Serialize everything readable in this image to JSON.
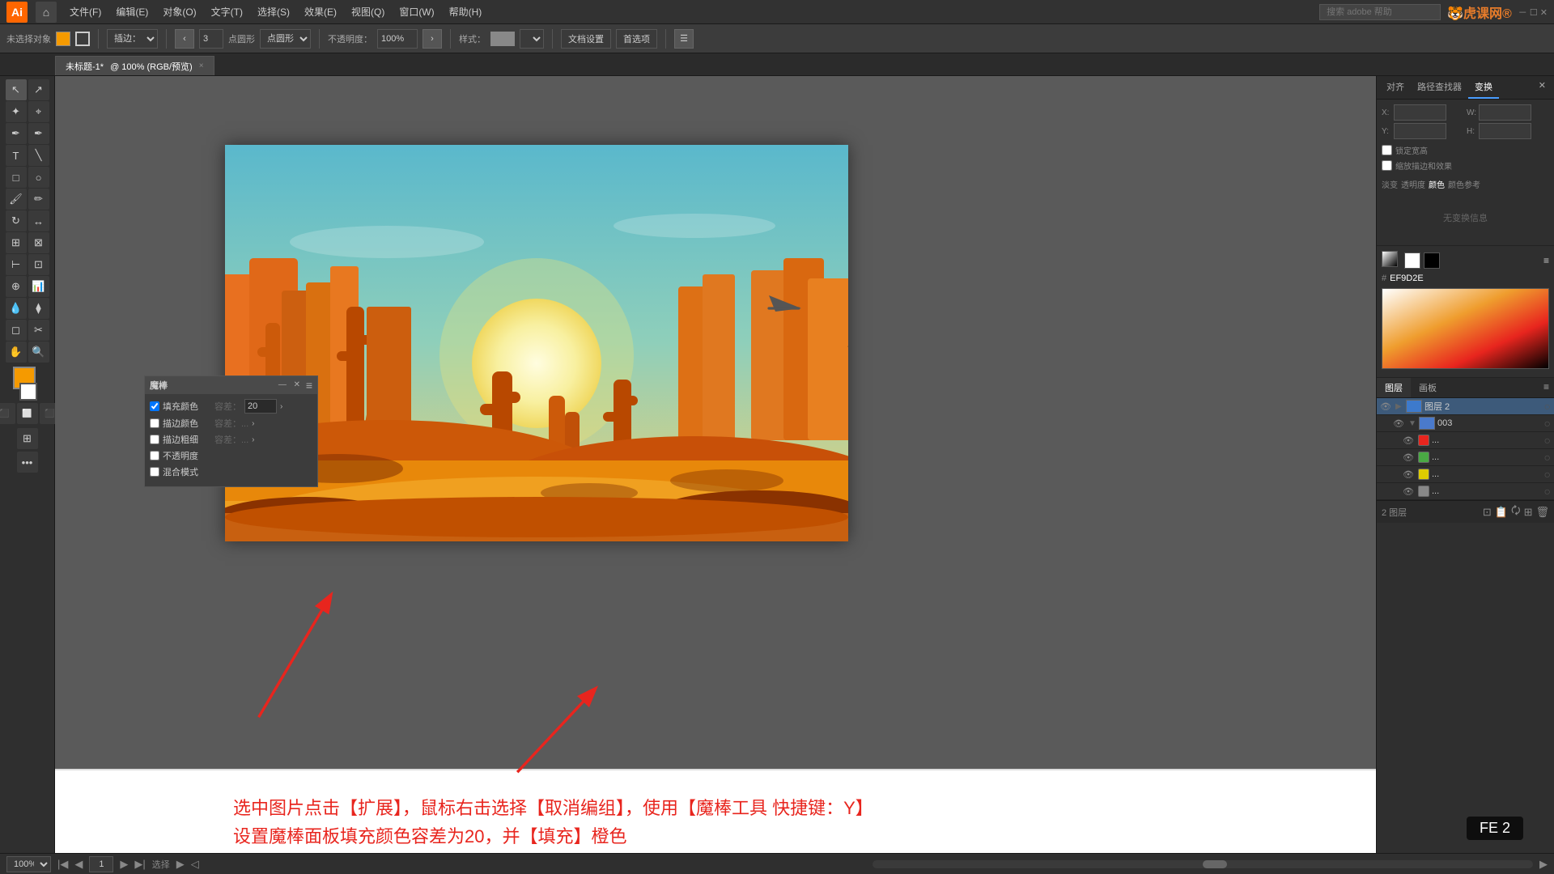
{
  "app": {
    "name": "Adobe Illustrator",
    "logo": "Ai",
    "version": "FE 2"
  },
  "menubar": {
    "items": [
      "文件(F)",
      "编辑(E)",
      "对象(O)",
      "文字(T)",
      "选择(S)",
      "效果(E)",
      "视图(Q)",
      "窗口(W)",
      "帮助(H)"
    ],
    "search_placeholder": "搜索 adobe 帮助",
    "home_icon": "⌂"
  },
  "toolbar": {
    "fill_label": "未选择对象",
    "stroke_label": "描边：",
    "warp_label": "插边：",
    "points_label": "3",
    "shape_label": "点圆形",
    "opacity_label": "不透明度：",
    "opacity_value": "100%",
    "style_label": "样式：",
    "doc_settings_label": "文档设置",
    "prefs_label": "首选项"
  },
  "tab": {
    "title": "未标题-1*",
    "subtitle": "@ 100% (RGB/预览)",
    "close_icon": "×"
  },
  "magic_wand": {
    "panel_title": "魔棒",
    "fill_color_label": "填充颜色",
    "fill_color_checked": true,
    "tolerance_label": "容差：",
    "tolerance_value": "20",
    "stroke_color_label": "描边颜色",
    "stroke_color_checked": false,
    "stroke_weight_label": "描边粗细",
    "stroke_weight_checked": false,
    "opacity_label": "不透明度",
    "opacity_checked": false,
    "blend_mode_label": "混合模式",
    "blend_mode_checked": false,
    "dim_text": "容差：",
    "dim_value": "..."
  },
  "right_panel": {
    "tabs": [
      "对齐",
      "路径查找器",
      "变换"
    ],
    "active_tab": "变换",
    "close_icon": "×",
    "no_status": "无变换信息",
    "checkboxes": [
      "锁定宽高",
      "缩放描边和效果"
    ],
    "color_hex": "EF9D2E",
    "panels": [
      "淡变",
      "透明度",
      "颜色",
      "颜色参考"
    ]
  },
  "layers_panel": {
    "tabs": [
      "图层",
      "画板"
    ],
    "active_tab": "图层",
    "layers": [
      {
        "name": "图层 2",
        "expanded": true,
        "selected": true,
        "color": "#4488ff"
      },
      {
        "name": "003",
        "expanded": false,
        "selected": false,
        "color": "#4488ff"
      },
      {
        "name": "...",
        "color": "#e8251e"
      },
      {
        "name": "...",
        "color": "#4aaa44"
      },
      {
        "name": "...",
        "color": "#ddcc00"
      },
      {
        "name": "...",
        "color": "#666666"
      }
    ],
    "bottom_labels": [
      "2 图层"
    ]
  },
  "instruction": {
    "line1": "选中图片点击【扩展】，鼠标右击选择【取消编组】，使用【魔棒工具 快捷键：Y】",
    "line2": "设置魔棒面板填充颜色容差为20，并【填充】橙色"
  },
  "status_bar": {
    "zoom_value": "100%",
    "page_number": "1",
    "select_label": "选择",
    "play_icon": "▶"
  },
  "watermark": {
    "text": "虎课网",
    "logo": "®"
  }
}
